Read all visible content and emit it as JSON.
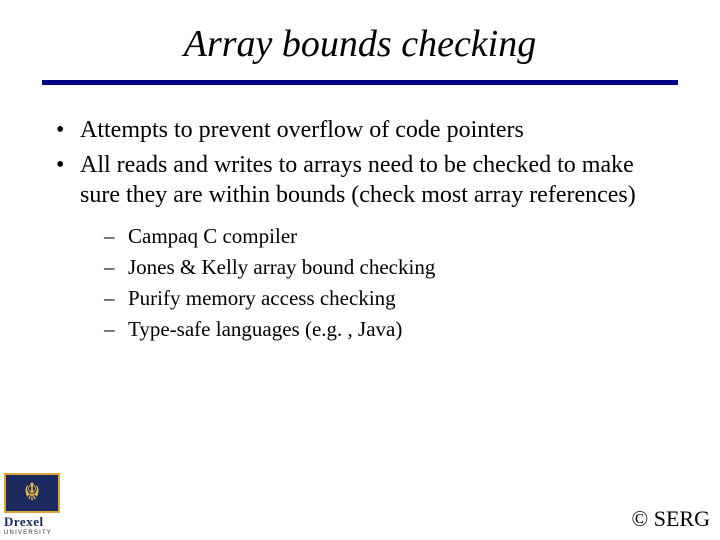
{
  "title": "Array bounds checking",
  "bullets": {
    "b0": "Attempts to prevent overflow of code pointers",
    "b1": "All reads and writes to arrays need to be checked to make sure they are within bounds (check most array references)",
    "sub": {
      "s0": "Campaq C compiler",
      "s1": "Jones & Kelly array bound checking",
      "s2": "Purify memory access checking",
      "s3": "Type-safe languages (e.g. , Java)"
    }
  },
  "logo": {
    "name": "Drexel",
    "sub": "UNIVERSITY"
  },
  "copyright": "© SERG"
}
